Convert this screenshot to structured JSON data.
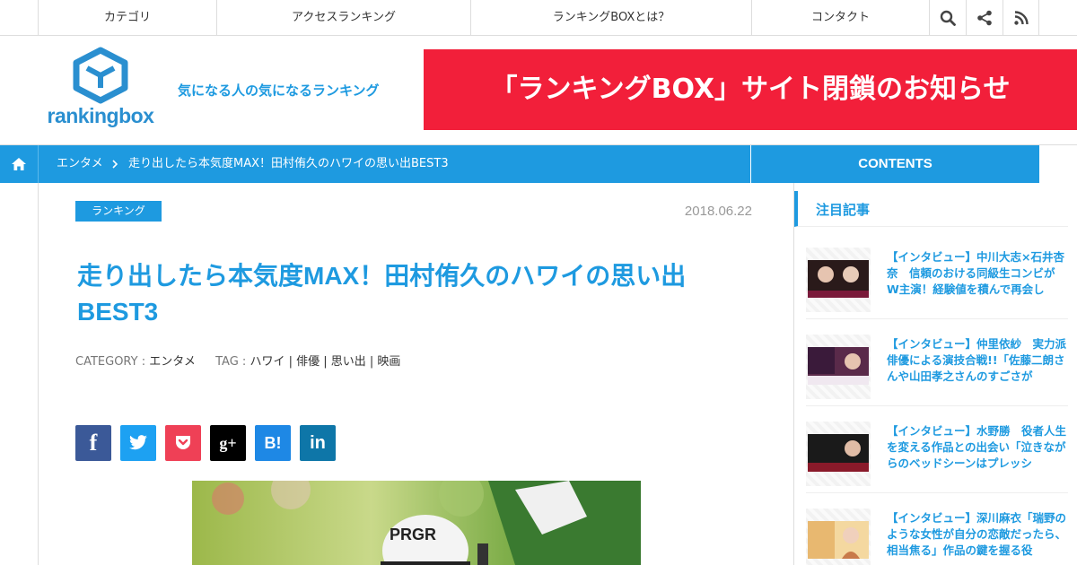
{
  "topnav": {
    "items": [
      "カテゴリ",
      "アクセスランキング",
      "ランキングBOXとは？",
      "コンタクト"
    ],
    "icons": [
      "search-icon",
      "share-icon",
      "rss-icon"
    ]
  },
  "header": {
    "logo_text": "rankingbox",
    "tagline": "気になる人の気になるランキング",
    "banner": "「ランキングBOX」サイト閉鎖のお知らせ"
  },
  "breadcrumb": {
    "category": "エンタメ",
    "current": "走り出したら本気度MAX！田村侑久のハワイの思い出BEST3",
    "contents_label": "CONTENTS"
  },
  "article": {
    "category_badge": "ランキング",
    "date": "2018.06.22",
    "title": "走り出したら本気度MAX！田村侑久のハワイの思い出BEST3",
    "category_label": "CATEGORY :",
    "category_value": "エンタメ",
    "tag_label": "TAG :",
    "tags": "ハワイ | 俳優 | 思い出 | 映画",
    "share": [
      {
        "glyph": "f",
        "color": "#3b5998"
      },
      {
        "glyph": "",
        "color": "#1da1f2"
      },
      {
        "glyph": "",
        "color": "#ef4056"
      },
      {
        "glyph": "g+",
        "color": "#000000"
      },
      {
        "glyph": "B!",
        "color": "#1e88e5"
      },
      {
        "glyph": "in",
        "color": "#0e76a8"
      }
    ],
    "photo_cap_text": "PRGR"
  },
  "sidebar": {
    "heading": "注目記事",
    "articles": [
      {
        "title": "【インタビュー】中川大志×石井杏奈　信頼のおける同級生コンビがW主演！経験値を積んで再会し"
      },
      {
        "title": "【インタビュー】仲里依紗　実力派俳優による演技合戦!!「佐藤二朗さんや山田孝之さんのすごさが"
      },
      {
        "title": "【インタビュー】水野勝　役者人生を変える作品との出会い「泣きながらのベッドシーンはプレッシ"
      },
      {
        "title": "【インタビュー】深川麻衣「瑞野のような女性が自分の恋敵だったら、相当焦る」作品の鍵を握る役"
      }
    ]
  },
  "colors": {
    "accent": "#1e9ae0",
    "banner": "#f21f3a"
  }
}
